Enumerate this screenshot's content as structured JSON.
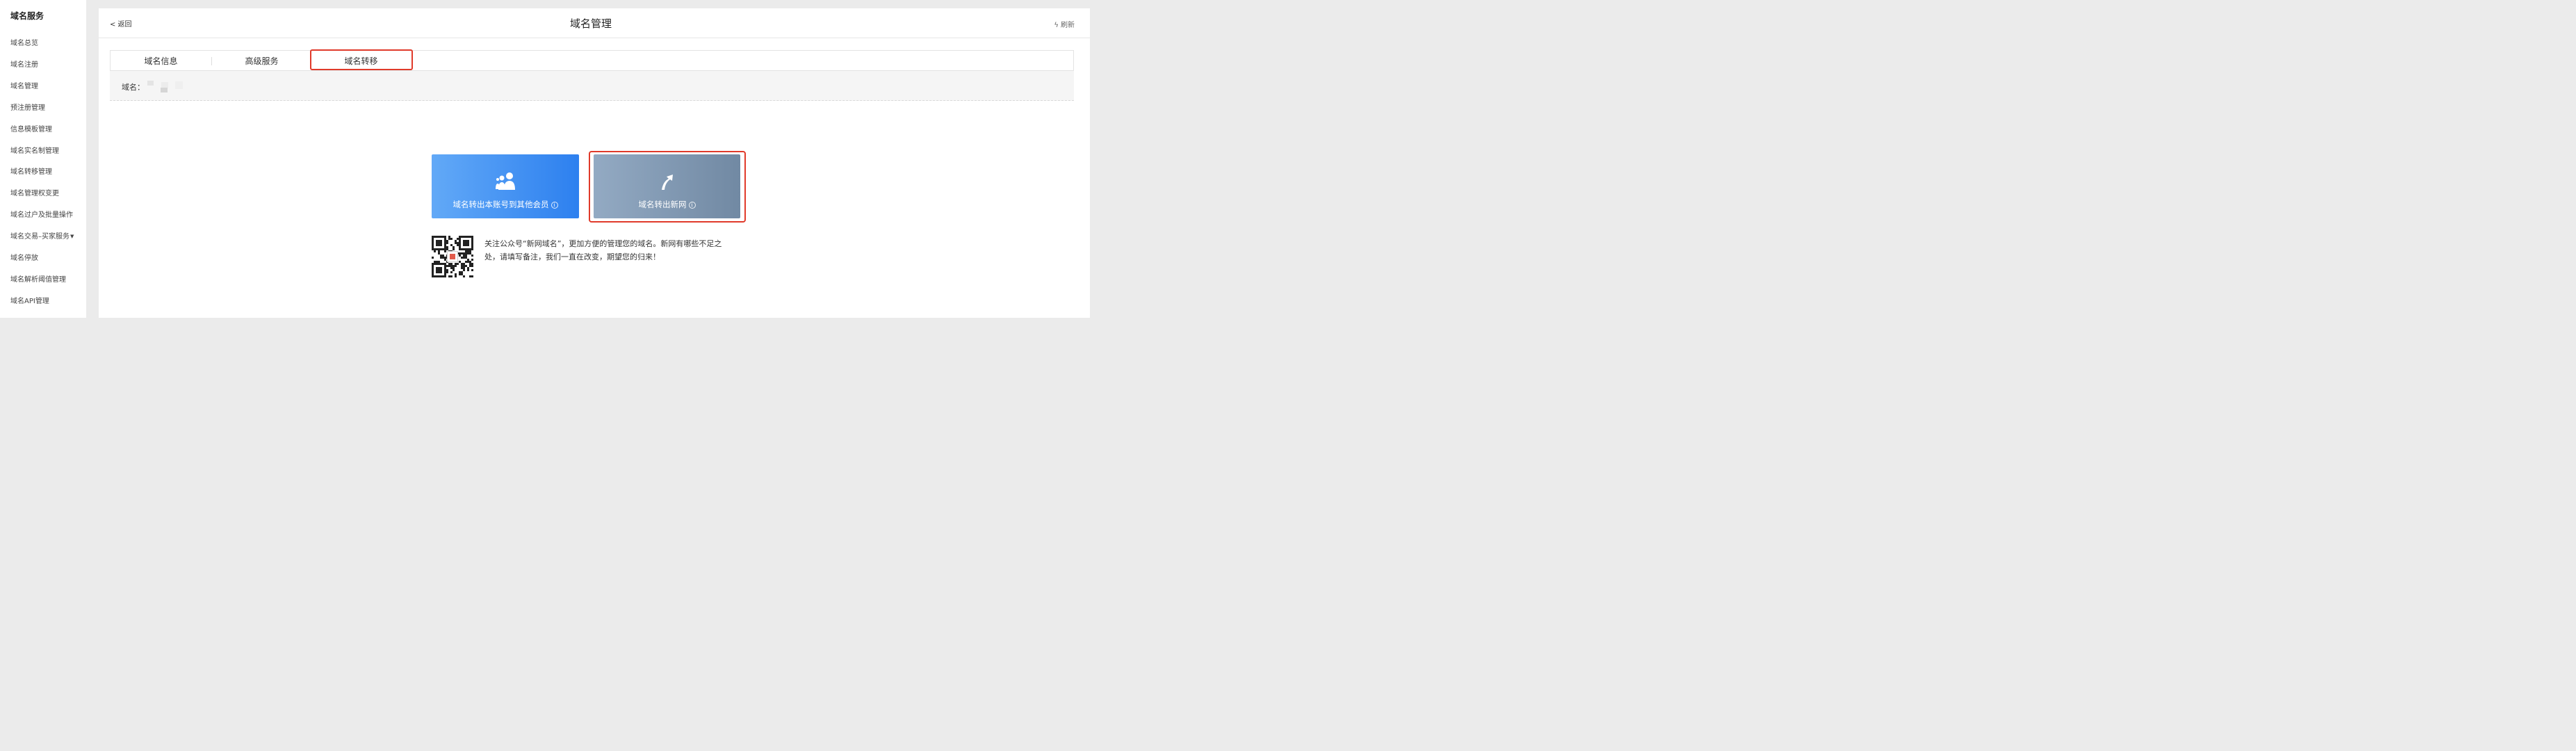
{
  "sidebar": {
    "title": "域名服务",
    "items": [
      {
        "label": "域名总览"
      },
      {
        "label": "域名注册"
      },
      {
        "label": "域名管理"
      },
      {
        "label": "预注册管理"
      },
      {
        "label": "信息模板管理"
      },
      {
        "label": "域名实名制管理"
      },
      {
        "label": "域名转移管理"
      },
      {
        "label": "域名管理权变更"
      },
      {
        "label": "域名过户及批量操作"
      },
      {
        "label": "域名交易–买家服务"
      },
      {
        "label": "域名停放"
      },
      {
        "label": "域名解析阈值管理"
      },
      {
        "label": "域名API管理"
      }
    ]
  },
  "header": {
    "back_label": "< 返回",
    "title": "域名管理",
    "refresh_label": "刷新"
  },
  "tabs": [
    {
      "label": "域名信息"
    },
    {
      "label": "高级服务"
    },
    {
      "label": "域名转移",
      "active": true
    }
  ],
  "domain": {
    "label": "域名："
  },
  "actions": {
    "transfer_member": {
      "label": "域名转出本账号到其他会员",
      "icon": "users-icon",
      "color_from": "#62a9f7",
      "color_to": "#2d80ef"
    },
    "transfer_out": {
      "label": "域名转出新网",
      "icon": "arrow-up-icon",
      "color_from": "#93aac3",
      "color_to": "#7189a3"
    }
  },
  "follow": {
    "text": "关注公众号“新网域名”，更加方便的管理您的域名。新网有哪些不足之处，请填写备注，我们一直在改变，期望您的归来！"
  },
  "colors": {
    "highlight": "#e03a2a"
  }
}
